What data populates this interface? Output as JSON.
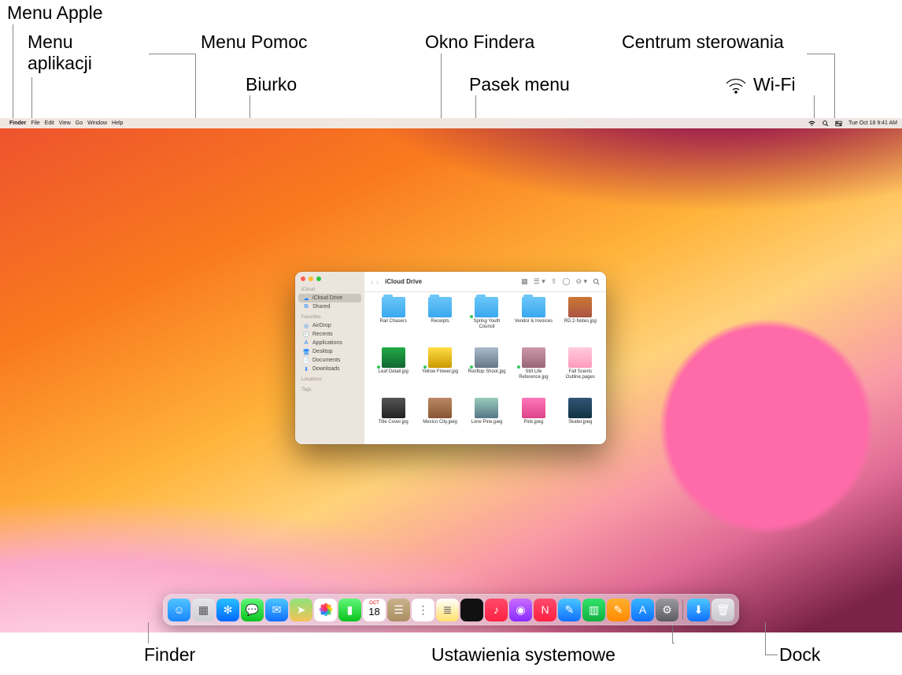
{
  "callouts": {
    "apple_menu": "Menu Apple",
    "app_menu": "Menu\naplikacji",
    "help_menu": "Menu Pomoc",
    "desktop": "Biurko",
    "finder_window": "Okno Findera",
    "menu_bar": "Pasek menu",
    "control_center": "Centrum sterowania",
    "wifi": "Wi-Fi",
    "finder": "Finder",
    "system_settings": "Ustawienia systemowe",
    "dock": "Dock"
  },
  "menubar": {
    "app": "Finder",
    "items": [
      "File",
      "Edit",
      "View",
      "Go",
      "Window",
      "Help"
    ],
    "datetime": "Tue Oct 18  9:41 AM"
  },
  "finder": {
    "title": "iCloud Drive",
    "sidebar": {
      "section1": "iCloud",
      "items1": [
        {
          "icon": "cloud",
          "label": "iCloud Drive",
          "selected": true
        },
        {
          "icon": "folder-shared",
          "label": "Shared",
          "selected": false
        }
      ],
      "section2": "Favorites",
      "items2": [
        {
          "icon": "airdrop",
          "label": "AirDrop"
        },
        {
          "icon": "clock",
          "label": "Recents"
        },
        {
          "icon": "apps",
          "label": "Applications"
        },
        {
          "icon": "desktop",
          "label": "Desktop"
        },
        {
          "icon": "doc",
          "label": "Documents"
        },
        {
          "icon": "download",
          "label": "Downloads"
        }
      ],
      "section3": "Locations",
      "section4": "Tags"
    },
    "files": [
      {
        "type": "folder",
        "name": "Rail Chasers"
      },
      {
        "type": "folder",
        "name": "Receipts"
      },
      {
        "type": "folder",
        "name": "Spring Youth Council",
        "synced": true
      },
      {
        "type": "folder",
        "name": "Vendor & Invoices"
      },
      {
        "type": "img",
        "name": "RD.2-Notes.jpg",
        "bg": "linear-gradient(#c73,#a54)"
      },
      {
        "type": "img",
        "name": "Leaf Detail.jpg",
        "bg": "linear-gradient(#2a4,#163)",
        "synced": true
      },
      {
        "type": "img",
        "name": "Yellow Flower.jpg",
        "bg": "linear-gradient(#fd4,#c90)",
        "synced": true
      },
      {
        "type": "img",
        "name": "Rooftop Shoot.jpg",
        "bg": "linear-gradient(#abc,#678)",
        "synced": true
      },
      {
        "type": "img",
        "name": "Still Life Reference.jpg",
        "bg": "linear-gradient(#c9a,#967)",
        "synced": true
      },
      {
        "type": "img",
        "name": "Fall Scents Outline.pages",
        "bg": "linear-gradient(#fcd,#f9b)"
      },
      {
        "type": "img",
        "name": "Title Cover.jpg",
        "bg": "linear-gradient(#555,#222)"
      },
      {
        "type": "img",
        "name": "Mexico City.jpeg",
        "bg": "linear-gradient(#b86,#853)"
      },
      {
        "type": "img",
        "name": "Lone Pine.jpeg",
        "bg": "linear-gradient(#9cb,#578)"
      },
      {
        "type": "img",
        "name": "Pink.jpeg",
        "bg": "linear-gradient(#f7b,#d48)"
      },
      {
        "type": "img",
        "name": "Skater.jpeg",
        "bg": "linear-gradient(#357,#134)"
      }
    ]
  },
  "dock": [
    {
      "name": "finder",
      "bg": "linear-gradient(#4fc4ff,#1986ff)",
      "glyph": "☺"
    },
    {
      "name": "launchpad",
      "bg": "linear-gradient(#e6e6ea,#cfcfd4)",
      "glyph": "▦"
    },
    {
      "name": "safari",
      "bg": "linear-gradient(#27c0ff,#0066ff)",
      "glyph": "✻"
    },
    {
      "name": "messages",
      "bg": "linear-gradient(#5ef777,#0bc31e)",
      "glyph": "💬"
    },
    {
      "name": "mail",
      "bg": "linear-gradient(#4ac6ff,#1170ff)",
      "glyph": "✉"
    },
    {
      "name": "maps",
      "bg": "linear-gradient(#8fe37a,#f3c257)",
      "glyph": "➤"
    },
    {
      "name": "photos",
      "bg": "#fff",
      "glyph": "✿"
    },
    {
      "name": "facetime",
      "bg": "linear-gradient(#5ef777,#0bc31e)",
      "glyph": "▮"
    },
    {
      "name": "calendar",
      "bg": "#fff",
      "glyph": "18"
    },
    {
      "name": "contacts",
      "bg": "linear-gradient(#c9b28a,#a98e62)",
      "glyph": "☰"
    },
    {
      "name": "reminders",
      "bg": "#fff",
      "glyph": "⋮"
    },
    {
      "name": "notes",
      "bg": "linear-gradient(#fff,#ffe06a)",
      "glyph": "≣"
    },
    {
      "name": "tv",
      "bg": "#111",
      "glyph": ""
    },
    {
      "name": "music",
      "bg": "linear-gradient(#ff4a6b,#ff2142)",
      "glyph": "♪"
    },
    {
      "name": "podcasts",
      "bg": "linear-gradient(#c86bff,#8a2bff)",
      "glyph": "◉"
    },
    {
      "name": "news",
      "bg": "linear-gradient(#ff4a6b,#ff2142)",
      "glyph": "N"
    },
    {
      "name": "freeform",
      "bg": "linear-gradient(#4ac6ff,#1170ff)",
      "glyph": "✎"
    },
    {
      "name": "numbers",
      "bg": "linear-gradient(#2fe36a,#10b040)",
      "glyph": "▥"
    },
    {
      "name": "pages",
      "bg": "linear-gradient(#ffb02e,#ff8a00)",
      "glyph": "✎"
    },
    {
      "name": "appstore",
      "bg": "linear-gradient(#36b7ff,#1170ff)",
      "glyph": "A"
    },
    {
      "name": "settings",
      "bg": "linear-gradient(#9a9aa0,#5c5c62)",
      "glyph": "⚙"
    },
    {
      "name": "sep",
      "sep": true
    },
    {
      "name": "downloads",
      "bg": "linear-gradient(#4ac6ff,#1170ff)",
      "glyph": "⬇"
    },
    {
      "name": "trash",
      "bg": "linear-gradient(#e6e6ea,#c7c7cd)",
      "glyph": "🗑"
    }
  ]
}
